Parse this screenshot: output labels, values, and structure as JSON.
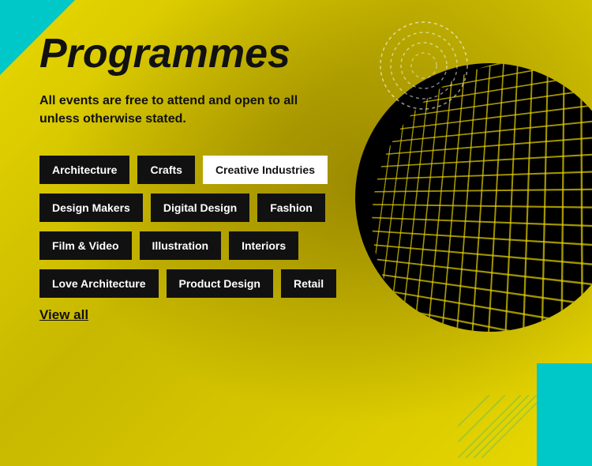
{
  "page": {
    "title": "Programmes",
    "subtitle": "All events are free to attend and open to all unless otherwise stated.",
    "viewAll": "View all"
  },
  "tags": [
    {
      "id": "architecture",
      "label": "Architecture",
      "style": "dark"
    },
    {
      "id": "crafts",
      "label": "Crafts",
      "style": "dark"
    },
    {
      "id": "creative-industries",
      "label": "Creative Industries",
      "style": "light"
    },
    {
      "id": "design-makers",
      "label": "Design Makers",
      "style": "dark"
    },
    {
      "id": "digital-design",
      "label": "Digital Design",
      "style": "dark"
    },
    {
      "id": "fashion",
      "label": "Fashion",
      "style": "dark"
    },
    {
      "id": "film-video",
      "label": "Film & Video",
      "style": "dark"
    },
    {
      "id": "illustration",
      "label": "Illustration",
      "style": "dark"
    },
    {
      "id": "interiors",
      "label": "Interiors",
      "style": "dark"
    },
    {
      "id": "love-architecture",
      "label": "Love Architecture",
      "style": "dark"
    },
    {
      "id": "product-design",
      "label": "Product Design",
      "style": "dark"
    },
    {
      "id": "retail",
      "label": "Retail",
      "style": "dark"
    }
  ],
  "colors": {
    "yellow": "#e8d800",
    "dark": "#111111",
    "teal": "#00c8c8",
    "white": "#ffffff"
  }
}
